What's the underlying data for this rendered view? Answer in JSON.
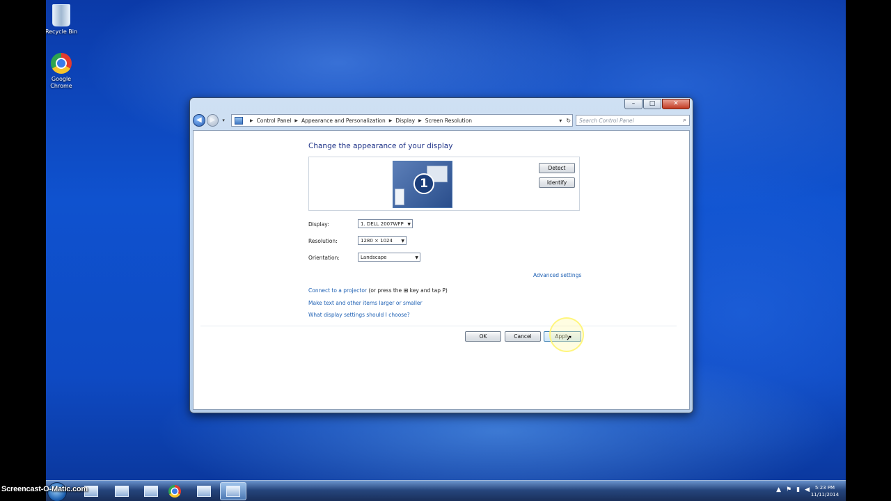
{
  "desktop": {
    "icons": [
      {
        "label": "Recycle Bin"
      },
      {
        "label": "Google Chrome"
      }
    ]
  },
  "window": {
    "caption": {
      "minimize": "–",
      "maximize": "□",
      "close": "✕"
    },
    "address_bar": {
      "crumbs": [
        "Control Panel",
        "Appearance and Personalization",
        "Display",
        "Screen Resolution"
      ],
      "dropdown": "▾",
      "refresh": "↻"
    },
    "search": {
      "placeholder": "Search Control Panel",
      "icon": "⌕"
    },
    "heading": "Change the appearance of your display",
    "monitor": {
      "number": "1"
    },
    "buttons": {
      "detect": "Detect",
      "identify": "Identify",
      "ok": "OK",
      "cancel": "Cancel",
      "apply": "Apply"
    },
    "fields": {
      "display": {
        "label": "Display:",
        "value": "1. DELL 2007WFP"
      },
      "resolution": {
        "label": "Resolution:",
        "value": "1280 × 1024"
      },
      "orientation": {
        "label": "Orientation:",
        "value": "Landscape"
      }
    },
    "links": {
      "advanced": "Advanced settings",
      "projector": "Connect to a projector",
      "projector_note_pre": "(or press the",
      "projector_note_post": "key and tap P)",
      "text_size": "Make text and other items larger or smaller",
      "help": "What display settings should I choose?"
    }
  },
  "taskbar": {
    "watermark": "Screencast-O-Matic.com",
    "clock": {
      "time": "5:23 PM",
      "date": "11/11/2014"
    }
  },
  "colors": {
    "link": "#1c5fb3",
    "heading": "#1e3287",
    "highlight": "#fff578"
  }
}
